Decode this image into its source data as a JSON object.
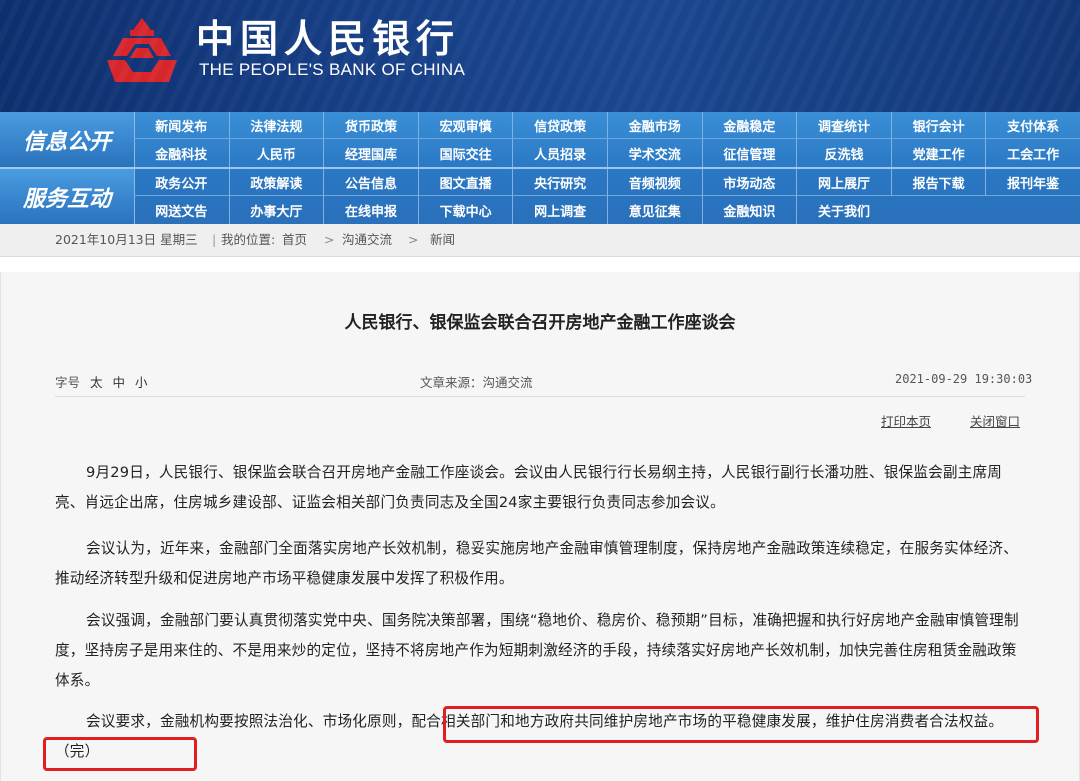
{
  "header": {
    "cn_title": "中国人民银行",
    "en_title": "THE PEOPLE'S BANK OF CHINA",
    "logo_icon": "pboc-logo-icon",
    "colors": {
      "banner": "#173f86",
      "logo": "#d7262b",
      "nav": "#2b78c4"
    }
  },
  "nav": {
    "section1_label": "信息公开",
    "section1_items": [
      "新闻发布",
      "法律法规",
      "货币政策",
      "宏观审慎",
      "信贷政策",
      "金融市场",
      "金融稳定",
      "调查统计",
      "银行会计",
      "支付体系",
      "金融科技",
      "人民币",
      "经理国库",
      "国际交往",
      "人员招录",
      "学术交流",
      "征信管理",
      "反洗钱",
      "党建工作",
      "工会工作"
    ],
    "section2_label": "服务互动",
    "section2_items": [
      "政务公开",
      "政策解读",
      "公告信息",
      "图文直播",
      "央行研究",
      "音频视频",
      "市场动态",
      "网上展厅",
      "报告下载",
      "报刊年鉴",
      "网送文告",
      "办事大厅",
      "在线申报",
      "下载中心",
      "网上调查",
      "意见征集",
      "金融知识",
      "关于我们"
    ]
  },
  "breadcrumb": {
    "date": "2021年10月13日 星期三",
    "sep": "|",
    "location_label": "我的位置:",
    "home": "首页",
    "arrow": ">",
    "section": "沟通交流",
    "page": "新闻"
  },
  "article": {
    "title": "人民银行、银保监会联合召开房地产金融工作座谈会",
    "fontsize_label": "字号",
    "fontsize_options": [
      "太",
      "中",
      "小"
    ],
    "source": "文章来源：沟通交流",
    "datetime": "2021-09-29 19:30:03",
    "print_link": "打印本页",
    "close_link": "关闭窗口",
    "paragraphs": [
      "9月29日，人民银行、银保监会联合召开房地产金融工作座谈会。会议由人民银行行长易纲主持，人民银行副行长潘功胜、银保监会副主席周亮、肖远企出席，住房城乡建设部、证监会相关部门负责同志及全国24家主要银行负责同志参加会议。",
      "会议认为，近年来，金融部门全面落实房地产长效机制，稳妥实施房地产金融审慎管理制度，保持房地产金融政策连续稳定，在服务实体经济、推动经济转型升级和促进房地产市场平稳健康发展中发挥了积极作用。",
      "会议强调，金融部门要认真贯彻落实党中央、国务院决策部署，围绕“稳地价、稳房价、稳预期”目标，准确把握和执行好房地产金融审慎管理制度，坚持房子是用来住的、不是用来炒的定位，坚持不将房地产作为短期刺激经济的手段，持续落实好房地产长效机制，加快完善住房租赁金融政策体系。",
      "会议要求，金融机构要按照法治化、市场化原则，配合相关部门和地方政府共同维护房地产市场的平稳健康发展，维护住房消费者合法权益。（完）"
    ],
    "highlight_color": "#e02020"
  }
}
